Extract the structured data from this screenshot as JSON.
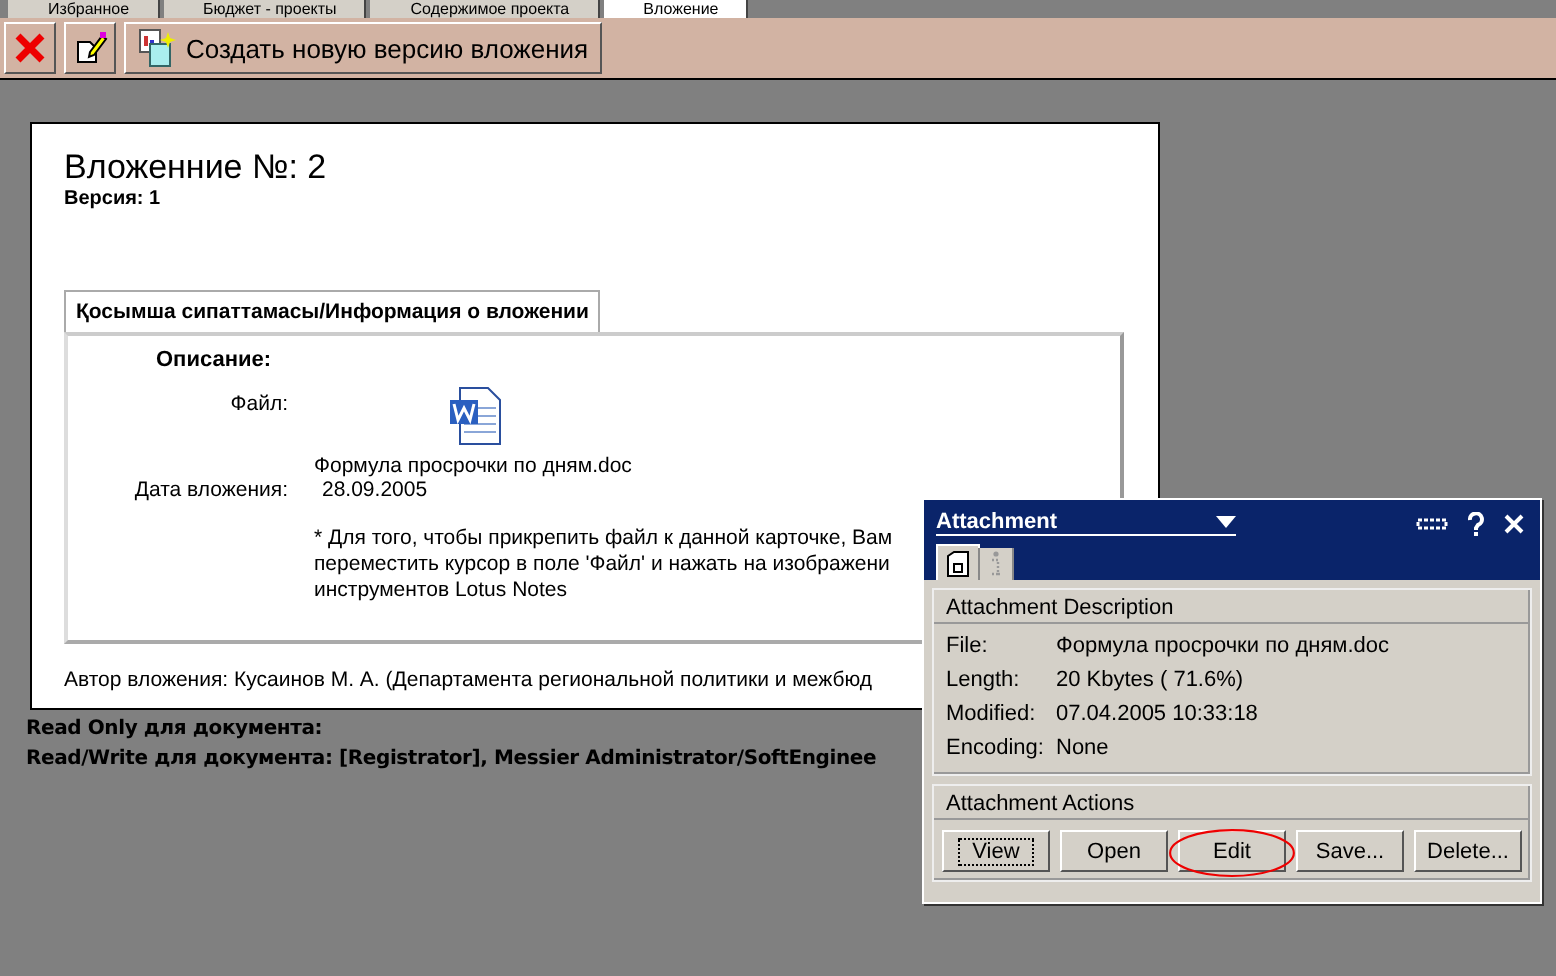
{
  "tabs": [
    {
      "label": "Избранное",
      "selected": false
    },
    {
      "label": "Бюджет - проекты",
      "selected": false
    },
    {
      "label": "Содержимое проекта",
      "selected": false
    },
    {
      "label": "Вложение",
      "selected": true
    }
  ],
  "toolbar": {
    "buttons": [
      {
        "kind": "close"
      },
      {
        "kind": "edit"
      },
      {
        "kind": "version",
        "label": "Создать новую версию вложения"
      }
    ]
  },
  "document": {
    "title": "Вложенние №: 2",
    "version": "Версия: 1",
    "section_tab": "Қосымша сипаттамасы/Информация о вложении",
    "description_label": "Описание:",
    "file_label": "Файл:",
    "file_name": "Формула просрочки по дням.doc",
    "date_label": "Дата вложения:",
    "date": "28.09.2005",
    "note": [
      "* Для того, чтобы прикрепить файл к данной карточке, Вам",
      "переместить курсор в поле 'Файл' и нажать на изображени",
      "инструментов Lotus Notes"
    ],
    "author": "Автор вложения: Кусаинов М. А. (Департамента региональной политики и межбюд"
  },
  "access": [
    "Read Only для документа:",
    "Read/Write для документа: [Registrator], Messier Administrator/SoftEnginee"
  ],
  "attachment_panel": {
    "title": "Attachment",
    "panel_tabs": [
      {
        "kind": "properties",
        "selected": true
      },
      {
        "kind": "info",
        "selected": false
      }
    ],
    "description_heading": "Attachment Description",
    "fields": [
      {
        "label": "File:",
        "value": "Формула просрочки по дням.doc"
      },
      {
        "label": "Length:",
        "value": "20 Kbytes ( 71.6%)"
      },
      {
        "label": "Modified:",
        "value": "07.04.2005 10:33:18"
      },
      {
        "label": "Encoding:",
        "value": "None"
      }
    ],
    "actions_heading": "Attachment Actions",
    "buttons": [
      {
        "label": "View",
        "focused": true,
        "circled": false
      },
      {
        "label": "Open",
        "focused": false,
        "circled": false
      },
      {
        "label": "Edit",
        "focused": false,
        "circled": true
      },
      {
        "label": "Save...",
        "focused": false,
        "circled": false
      },
      {
        "label": "Delete...",
        "focused": false,
        "circled": false
      }
    ]
  }
}
